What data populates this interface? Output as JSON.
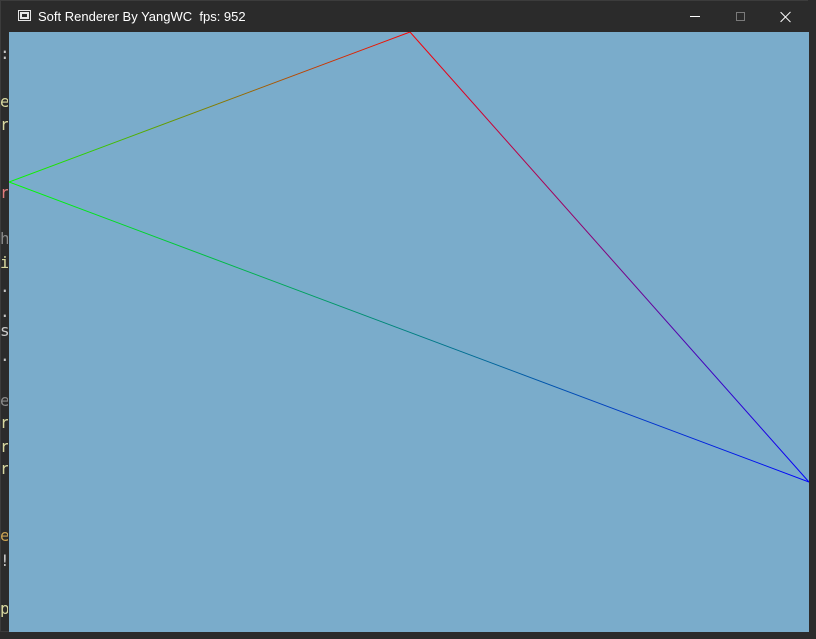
{
  "window": {
    "title": "Soft Renderer By YangWC  fps: 952"
  },
  "titlebar_buttons": {
    "minimize_icon": "minimize-icon",
    "maximize_icon": "maximize-icon",
    "close_icon": "close-icon"
  },
  "viewport": {
    "clear_color": "#7aaccb",
    "triangle": {
      "vertices": [
        {
          "name": "top",
          "color": "#ff0000"
        },
        {
          "name": "left",
          "color": "#00ff00"
        },
        {
          "name": "right",
          "color": "#0000ff"
        }
      ]
    }
  },
  "background_editor": {
    "left_glyphs": [
      {
        "text": ":",
        "color": "#c8c8c8"
      },
      {
        "text": "e",
        "color": "#d8d8a0"
      },
      {
        "text": "r",
        "color": "#d8d8a0"
      },
      {
        "text": "r",
        "color": "#e07b7b"
      },
      {
        "text": "h",
        "color": "#8a8a8a"
      },
      {
        "text": "i",
        "color": "#d8d8a0"
      },
      {
        "text": ".",
        "color": "#c8c8c8"
      },
      {
        "text": ".",
        "color": "#c8c8c8"
      },
      {
        "text": "s",
        "color": "#c8c8c8"
      },
      {
        "text": ".",
        "color": "#c8c8c8"
      },
      {
        "text": "e",
        "color": "#8a8a8a"
      },
      {
        "text": "r",
        "color": "#d8d8a0"
      },
      {
        "text": "r",
        "color": "#d8d8a0"
      },
      {
        "text": "r",
        "color": "#d8d8a0"
      },
      {
        "text": "e",
        "color": "#c9a253"
      },
      {
        "text": "!",
        "color": "#c8c8c8"
      },
      {
        "text": "p",
        "color": "#d8d8a0"
      }
    ]
  }
}
